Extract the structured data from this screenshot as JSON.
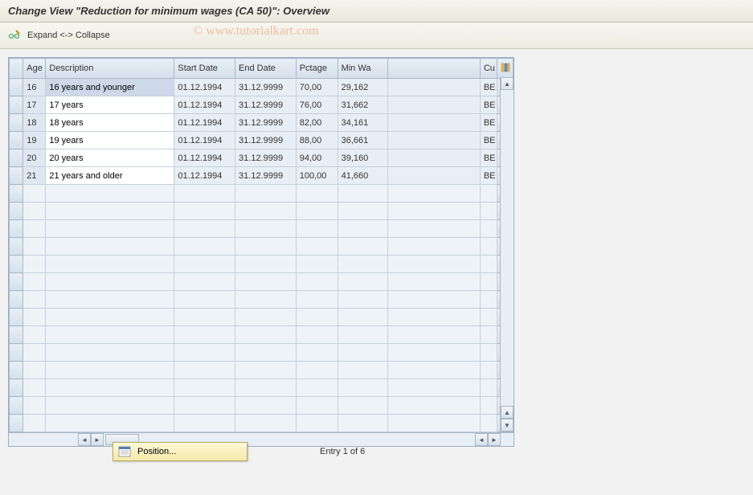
{
  "title": "Change View \"Reduction for minimum wages (CA 50)\": Overview",
  "toolbar": {
    "expand_collapse": "Expand <-> Collapse"
  },
  "table": {
    "headers": {
      "age": "Age",
      "description": "Description",
      "start_date": "Start Date",
      "end_date": "End Date",
      "pctage": "Pctage",
      "min_wa": "Min Wa",
      "cu": "Cu"
    },
    "rows": [
      {
        "age": "16",
        "description": "16 years and younger",
        "start_date": "01.12.1994",
        "end_date": "31.12.9999",
        "pctage": "70,00",
        "min_wa": "29,162",
        "cu": "BE"
      },
      {
        "age": "17",
        "description": "17 years",
        "start_date": "01.12.1994",
        "end_date": "31.12.9999",
        "pctage": "76,00",
        "min_wa": "31,662",
        "cu": "BE"
      },
      {
        "age": "18",
        "description": "18 years",
        "start_date": "01.12.1994",
        "end_date": "31.12.9999",
        "pctage": "82,00",
        "min_wa": "34,161",
        "cu": "BE"
      },
      {
        "age": "19",
        "description": "19 years",
        "start_date": "01.12.1994",
        "end_date": "31.12.9999",
        "pctage": "88,00",
        "min_wa": "36,661",
        "cu": "BE"
      },
      {
        "age": "20",
        "description": "20 years",
        "start_date": "01.12.1994",
        "end_date": "31.12.9999",
        "pctage": "94,00",
        "min_wa": "39,160",
        "cu": "BE"
      },
      {
        "age": "21",
        "description": "21 years and older",
        "start_date": "01.12.1994",
        "end_date": "31.12.9999",
        "pctage": "100,00",
        "min_wa": "41,660",
        "cu": "BE"
      }
    ]
  },
  "footer": {
    "position_label": "Position...",
    "entry_text": "Entry 1 of 6"
  },
  "watermark": "© www.tutorialkart.com"
}
